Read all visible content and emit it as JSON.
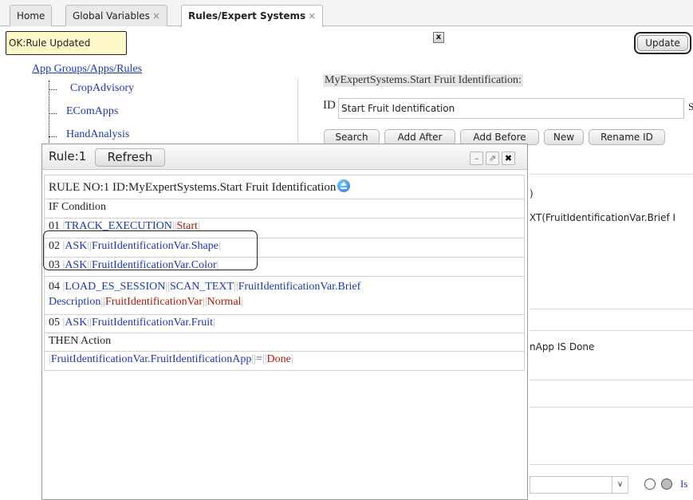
{
  "tabs": [
    {
      "label": "Home",
      "closable": false,
      "active": false
    },
    {
      "label": "Global Variables",
      "closable": true,
      "active": false
    },
    {
      "label": "Rules/Expert Systems",
      "closable": true,
      "active": true
    }
  ],
  "tab_close_glyph": "×",
  "status": {
    "text": "OK:Rule Updated",
    "close_label": "x"
  },
  "update_label": "Update",
  "tree": {
    "root_label": "App Groups/Apps/Rules",
    "items": [
      "CropAdvisory",
      "EComApps",
      "HandAnalysis"
    ]
  },
  "rule_panel": {
    "title": "MyExpertSystems.Start Fruit Identification:",
    "id_label": "ID",
    "id_value": "Start Fruit Identification",
    "trailing_char": "S",
    "buttons": [
      "Search",
      "Add After",
      "Add Before",
      "New",
      "Rename ID"
    ],
    "partial_texts": [
      ")",
      "XT(FruitIdentificationVar.Brief I",
      "nApp IS Done"
    ],
    "is_label": "Is"
  },
  "dialog": {
    "title": "Rule:1",
    "refresh_label": "Refresh",
    "header_line": "RULE NO:1 ID:MyExpertSystems.Start Fruit Identification",
    "if_label": "IF Condition",
    "then_label": "THEN Action",
    "conditions": [
      {
        "num": "01",
        "parts": [
          {
            "t": "TRACK_EXECUTION",
            "c": "blue"
          },
          {
            "t": "Start",
            "c": "red"
          }
        ]
      },
      {
        "num": "02",
        "parts": [
          {
            "t": "ASK",
            "c": "blue"
          },
          {
            "t": "FruitIdentificationVar.Shape",
            "c": "blue"
          }
        ]
      },
      {
        "num": "03",
        "parts": [
          {
            "t": "ASK",
            "c": "blue"
          },
          {
            "t": "FruitIdentificationVar.Color",
            "c": "blue"
          }
        ]
      },
      {
        "num": "04",
        "parts": [
          {
            "t": "LOAD_ES_SESSION",
            "c": "blue"
          },
          {
            "t": "SCAN_TEXT",
            "c": "blue"
          },
          {
            "t": "FruitIdentificationVar.Brief Description",
            "c": "blue"
          },
          {
            "t": "FruitIdentificationVar",
            "c": "red"
          },
          {
            "t": "Normal",
            "c": "red"
          }
        ]
      },
      {
        "num": "05",
        "parts": [
          {
            "t": "ASK",
            "c": "blue"
          },
          {
            "t": "FruitIdentificationVar.Fruit",
            "c": "blue"
          }
        ]
      }
    ],
    "actions": [
      {
        "parts": [
          {
            "t": "FruitIdentificationVar.FruitIdentificationApp",
            "c": "blue"
          },
          {
            "t": "=",
            "c": "blue"
          },
          {
            "t": "Done",
            "c": "red"
          }
        ]
      }
    ],
    "window_icons": [
      "minimize-icon",
      "popout-icon",
      "close-icon"
    ]
  },
  "colors": {
    "link": "#1a3aa8",
    "value": "#a8190c",
    "status_bg": "#fff9c9"
  }
}
